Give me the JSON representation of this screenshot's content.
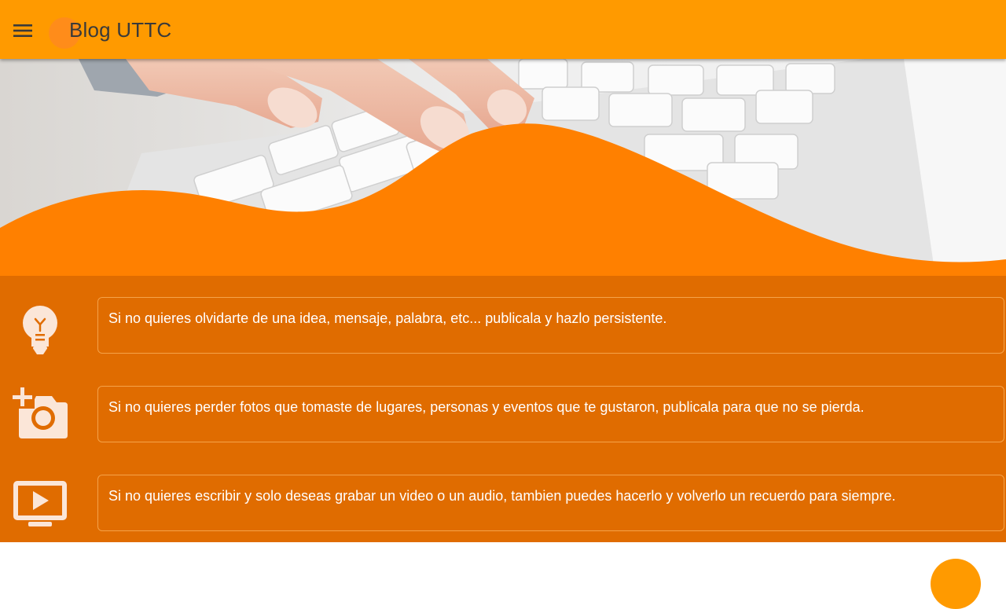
{
  "appbar": {
    "title": "Blog UTTC",
    "menu_icon": "menu-icon",
    "background": "#ff9a00"
  },
  "hero": {
    "image": "typing-on-keyboard-photo",
    "wave_color": "#ff8000"
  },
  "features": {
    "background": "#e06c00",
    "items": [
      {
        "icon": "lightbulb-icon",
        "text": "Si no quieres olvidarte de una idea, mensaje, palabra, etc... publicala y hazlo persistente."
      },
      {
        "icon": "add-photo-icon",
        "text": "Si no quieres perder fotos que tomaste de lugares, personas y eventos que te gustaron, publicala para que no se pierda."
      },
      {
        "icon": "video-icon",
        "text": "Si no quieres escribir y solo deseas grabar un video o un audio, tambien puedes hacerlo y volverlo un recuerdo para siempre."
      }
    ]
  },
  "fab": {
    "icon": "fab-icon",
    "color": "#ff9a00"
  }
}
